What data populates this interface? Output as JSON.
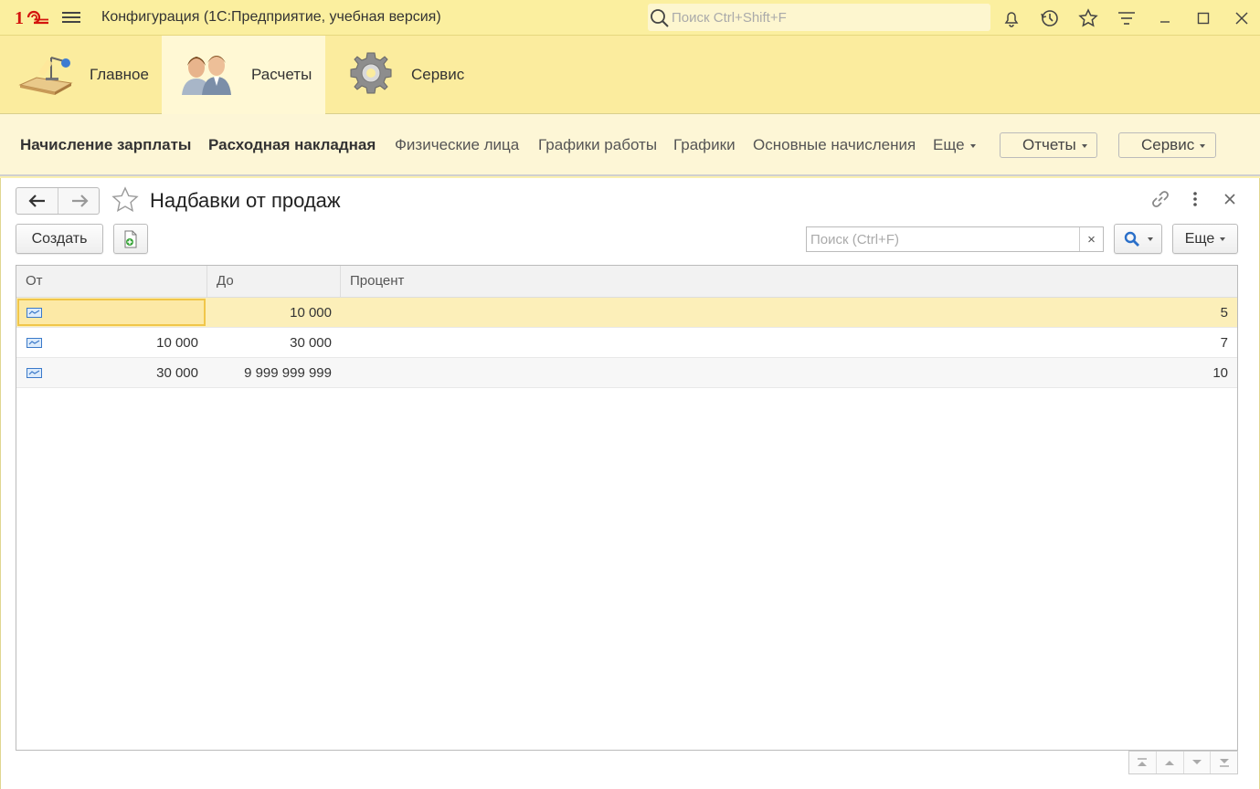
{
  "titlebar": {
    "logo": "1С",
    "title": "Конфигурация  (1С:Предприятие, учебная версия)",
    "search_placeholder": "Поиск Ctrl+Shift+F"
  },
  "sections": [
    {
      "label": "Главное",
      "icon": "desk-lamp-icon"
    },
    {
      "label": "Расчеты",
      "icon": "people-icon"
    },
    {
      "label": "Сервис",
      "icon": "gear-icon"
    }
  ],
  "funcbar": {
    "links": [
      {
        "label": "Начисление зарплаты",
        "bold": true
      },
      {
        "label": "Расходная накладная",
        "bold": true
      },
      {
        "label": "Физические лица",
        "bold": false
      },
      {
        "label": "Графики работы",
        "bold": false
      },
      {
        "label": "Графики",
        "bold": false
      },
      {
        "label": "Основные начисления",
        "bold": false
      },
      {
        "label": "Еще",
        "bold": false
      }
    ],
    "reports_label": "Отчеты",
    "service_label": "Сервис"
  },
  "form": {
    "title": "Надбавки от продаж",
    "create_label": "Создать",
    "search_placeholder": "Поиск (Ctrl+F)",
    "more_label": "Еще",
    "clear_symbol": "×"
  },
  "table": {
    "columns": [
      "От",
      "До",
      "Процент"
    ],
    "rows": [
      {
        "from": "",
        "to": "10 000",
        "percent": "5",
        "selected": true
      },
      {
        "from": "10 000",
        "to": "30 000",
        "percent": "7",
        "selected": false
      },
      {
        "from": "30 000",
        "to": "9 999 999 999",
        "percent": "10",
        "selected": false
      }
    ]
  },
  "colors": {
    "titlebar_bg": "#fbef9f",
    "sections_bg": "#fbec9e",
    "active_section_bg": "#fff8d4",
    "selected_row_bg": "#fcefb9",
    "focus_border": "#f0c64a",
    "logo_red": "#d3140d"
  }
}
